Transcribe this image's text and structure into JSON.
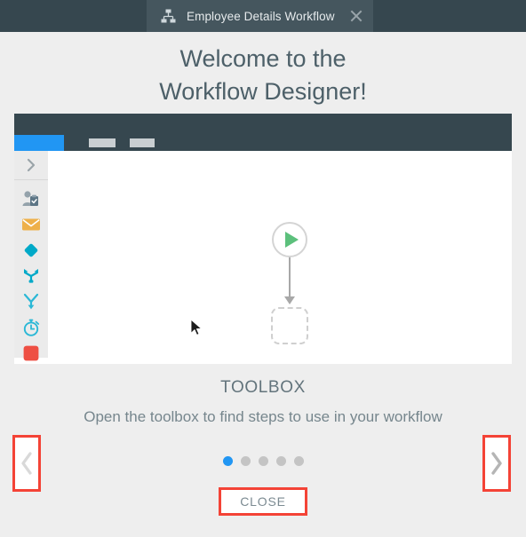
{
  "window": {
    "tab": {
      "icon": "hierarchy-icon",
      "title": "Employee Details Workflow",
      "close_icon": "close-icon"
    },
    "topbar_color": "#36474f",
    "tab_color": "#45565e"
  },
  "headline": {
    "line1": "Welcome to the",
    "line2": "Workflow Designer!"
  },
  "illustration": {
    "toolbar": {
      "active_tab_color": "#2196f3",
      "stubs": [
        "toolbar-stub-1",
        "toolbar-stub-2"
      ]
    },
    "sidebar": {
      "expand_icon": "chevron-right-icon",
      "items": [
        {
          "icon": "user-task-icon",
          "color": "#8a9aa3"
        },
        {
          "icon": "envelope-icon",
          "color": "#e8a33d"
        },
        {
          "icon": "decision-diamond-icon",
          "color": "#00a3c4"
        },
        {
          "icon": "merge-icon",
          "color": "#00a3c4"
        },
        {
          "icon": "fork-icon",
          "color": "#29b6d8"
        },
        {
          "icon": "timer-icon",
          "color": "#29b6d8"
        },
        {
          "icon": "stop-icon",
          "color": "#ef4f43"
        }
      ]
    },
    "canvas": {
      "start_node": {
        "icon": "play-icon",
        "color": "#5cc07c"
      },
      "connector": {
        "icon": "arrow-down-icon",
        "color": "#a8a8a8"
      },
      "placeholder_node": "empty-step-placeholder",
      "cursor": "mouse-cursor"
    }
  },
  "caption": {
    "title": "TOOLBOX",
    "subtitle": "Open the toolbox to find steps to use in your workflow"
  },
  "pagination": {
    "total": 5,
    "active_index": 0
  },
  "nav": {
    "prev_icon": "chevron-left-icon",
    "next_icon": "chevron-right-icon",
    "highlight_color": "#f44336"
  },
  "footer": {
    "close_label": "CLOSE"
  }
}
